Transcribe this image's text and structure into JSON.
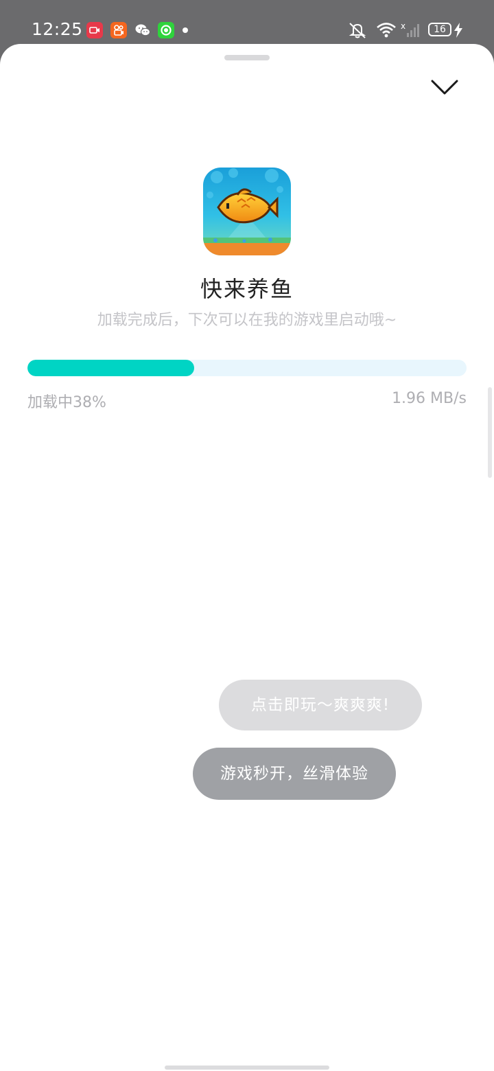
{
  "status_bar": {
    "time": "12:25",
    "battery_level": "16",
    "notification_icons": [
      "video-app-icon",
      "kuaishou-icon",
      "wechat-icon",
      "green-app-icon"
    ],
    "system_icons": [
      "mute-icon",
      "wifi-icon",
      "signal-icon",
      "battery-icon",
      "charging-icon"
    ]
  },
  "sheet": {
    "collapse_icon": "chevron-down-icon",
    "game": {
      "icon": "goldfish-game-icon",
      "title": "快来养鱼",
      "subtitle": "加载完成后，下次可以在我的游戏里启动哦~"
    },
    "loading": {
      "status_label": "加载中38%",
      "progress_fraction": 0.38,
      "speed": "1.96 MB/s"
    },
    "bubbles": [
      {
        "text": "点击即玩～爽爽爽!"
      },
      {
        "text": "游戏秒开，丝滑体验"
      }
    ]
  },
  "colors": {
    "progress_fill": "#00d4c4",
    "progress_track": "#e8f6fd",
    "status_bar_bg": "#6b6b6d"
  }
}
